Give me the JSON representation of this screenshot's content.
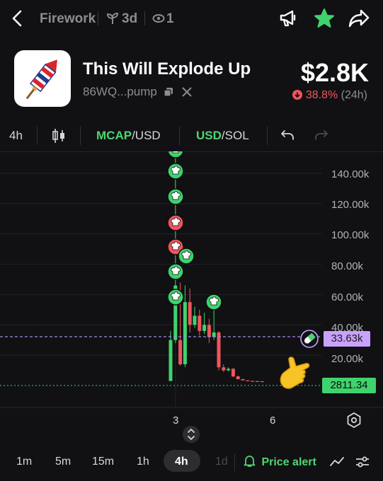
{
  "nav": {
    "back_icon": "chevron-left-icon",
    "platform": "Firework",
    "age": "3d",
    "watchers": "1",
    "actions": [
      "megaphone-icon",
      "star-icon",
      "share-icon"
    ]
  },
  "token": {
    "name": "This Will Explode Up",
    "address": "86WQ...pump",
    "price": "$2.8K",
    "change": "38.8%",
    "period": "(24h)",
    "logo_icon": "firework-rocket-icon"
  },
  "toolbar": {
    "interval": "4h",
    "mcap": "MCAP",
    "mcap_unit": "/USD",
    "usd": "USD",
    "usd_unit": "/SOL"
  },
  "chart": {
    "y_labels": [
      "140.00k",
      "120.00k",
      "100.00k",
      "80.00k",
      "60.00k",
      "40.00k",
      "20.00k"
    ],
    "x_labels": [
      "3",
      "6"
    ],
    "last_price": "2811.34",
    "crosshair_value": "33.63k",
    "colors": {
      "up": "#3fd36d",
      "down": "#f0565b",
      "crosshair": "#a98be8"
    }
  },
  "chart_data": {
    "type": "candlestick",
    "x_tick_labels": [
      "3",
      "6"
    ],
    "ylim": [
      0,
      150000
    ],
    "y_tick_labels": [
      "20.00k",
      "40.00k",
      "60.00k",
      "80.00k",
      "100.00k",
      "120.00k",
      "140.00k"
    ],
    "last_value": 2811.34,
    "crosshair_value": 33630,
    "candles": [
      {
        "o": 3000,
        "c": 30000,
        "h": 36000,
        "l": 2800
      },
      {
        "o": 30000,
        "c": 66000,
        "h": 150000,
        "l": 28000
      },
      {
        "o": 30000,
        "c": 14000,
        "h": 68000,
        "l": 13000
      },
      {
        "o": 14000,
        "c": 55000,
        "h": 66000,
        "l": 12000
      },
      {
        "o": 55000,
        "c": 40000,
        "h": 64000,
        "l": 35000
      },
      {
        "o": 40000,
        "c": 46000,
        "h": 52000,
        "l": 38000
      },
      {
        "o": 46000,
        "c": 36000,
        "h": 50000,
        "l": 33000
      },
      {
        "o": 36000,
        "c": 40000,
        "h": 48000,
        "l": 34000
      },
      {
        "o": 40000,
        "c": 32000,
        "h": 44000,
        "l": 28000
      },
      {
        "o": 32000,
        "c": 35000,
        "h": 52000,
        "l": 30000
      },
      {
        "o": 35000,
        "c": 12000,
        "h": 36000,
        "l": 10000
      },
      {
        "o": 12000,
        "c": 10000,
        "h": 14000,
        "l": 9000
      },
      {
        "o": 10000,
        "c": 11000,
        "h": 12000,
        "l": 9500
      },
      {
        "o": 11000,
        "c": 6000,
        "h": 11500,
        "l": 5500
      },
      {
        "o": 6000,
        "c": 4200,
        "h": 6500,
        "l": 4000
      },
      {
        "o": 4200,
        "c": 3400,
        "h": 4400,
        "l": 3300
      },
      {
        "o": 3400,
        "c": 3000,
        "h": 3500,
        "l": 2900
      },
      {
        "o": 3000,
        "c": 2900,
        "h": 3100,
        "l": 2850
      },
      {
        "o": 2900,
        "c": 2820,
        "h": 2950,
        "l": 2800
      },
      {
        "o": 2820,
        "c": 2811,
        "h": 2850,
        "l": 2800
      }
    ]
  },
  "bottom": {
    "timeframes": [
      "1m",
      "5m",
      "15m",
      "1h",
      "4h",
      "1d"
    ],
    "price_alert": "Price alert"
  }
}
